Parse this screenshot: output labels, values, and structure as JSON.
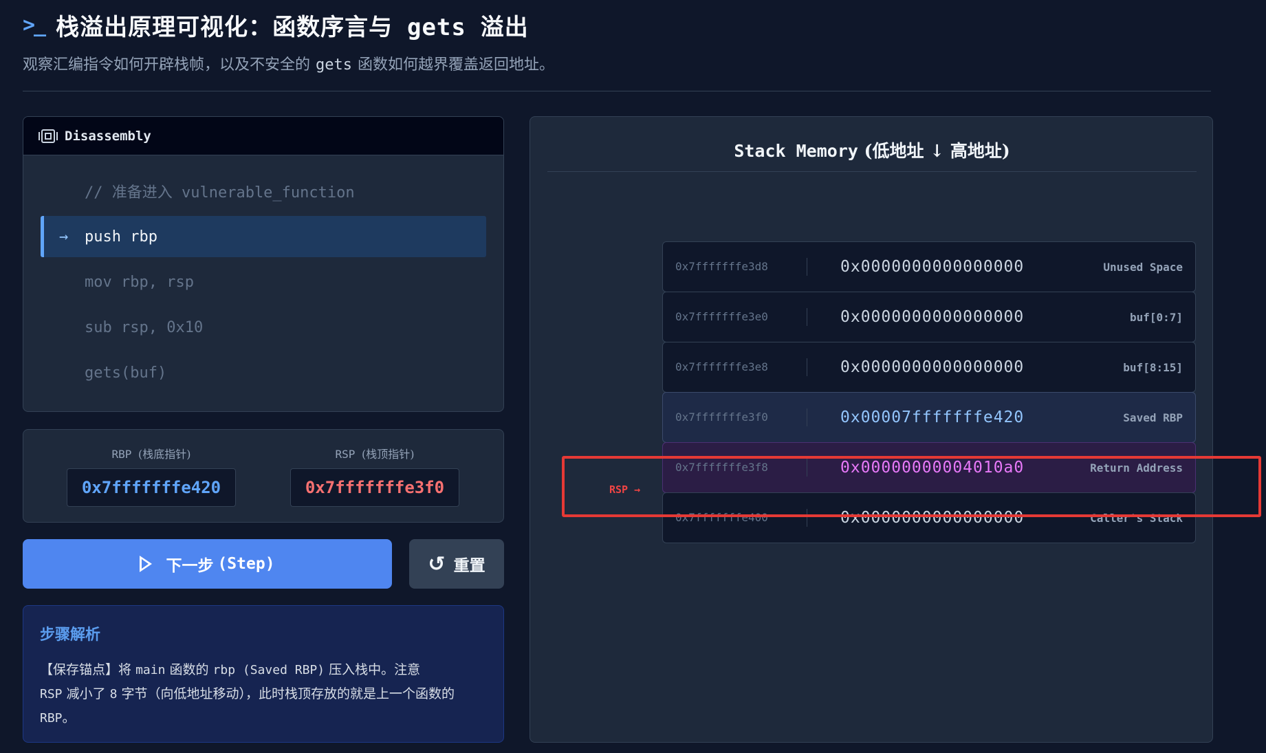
{
  "header": {
    "title_prefix": "栈溢出原理可视化：函数序言与",
    "title_code": "gets",
    "title_suffix": "溢出",
    "subtitle_prefix": "观察汇编指令如何开辟栈帧，以及不安全的",
    "subtitle_code": "gets",
    "subtitle_suffix": "函数如何越界覆盖返回地址。"
  },
  "disassembly": {
    "title": "Disassembly",
    "lines": [
      {
        "text": "// 准备进入 vulnerable_function",
        "active": false
      },
      {
        "text": "push rbp",
        "active": true
      },
      {
        "text": "mov rbp, rsp",
        "active": false
      },
      {
        "text": "sub rsp, 0x10",
        "active": false
      },
      {
        "text": "gets(buf)",
        "active": false
      }
    ],
    "active_marker": "→"
  },
  "registers": {
    "rbp": {
      "label": "RBP",
      "label_cn": "(栈底指针)",
      "value": "0x7fffffffe420"
    },
    "rsp": {
      "label": "RSP",
      "label_cn": "(栈顶指针)",
      "value": "0x7fffffffe3f0"
    }
  },
  "buttons": {
    "step_label": "下一步",
    "step_code": "(Step)",
    "reset_label": "重置",
    "reset_icon": "↺"
  },
  "explanation": {
    "title": "步骤解析",
    "p1": "【保存锚点】将",
    "c1": "main",
    "p2": "函数的",
    "c2": "rbp (Saved RBP)",
    "p3": "压入栈中。注意",
    "c3": "RSP",
    "p4": "减小了",
    "c4": "8",
    "p5": "字节（向低地址移动），此时栈顶存放的就是上一个函数的",
    "c5": "RBP",
    "p6": "。"
  },
  "stack": {
    "title_code": "Stack Memory",
    "title_cn": "(低地址 ↓ 高地址)",
    "rsp_pointer": "RSP →",
    "rows": [
      {
        "addr": "0x7fffffffe3d8",
        "value": "0x0000000000000000",
        "label": "Unused Space",
        "kind": "normal"
      },
      {
        "addr": "0x7fffffffe3e0",
        "value": "0x0000000000000000",
        "label": "buf[0:7]",
        "kind": "normal"
      },
      {
        "addr": "0x7fffffffe3e8",
        "value": "0x0000000000000000",
        "label": "buf[8:15]",
        "kind": "normal"
      },
      {
        "addr": "0x7fffffffe3f0",
        "value": "0x00007fffffffe420",
        "label": "Saved RBP",
        "kind": "saved"
      },
      {
        "addr": "0x7fffffffe3f8",
        "value": "0x00000000004010a0",
        "label": "Return Address",
        "kind": "ret"
      },
      {
        "addr": "0x7fffffffe400",
        "value": "0x0000000000000000",
        "label": "Caller's Stack",
        "kind": "normal"
      }
    ]
  },
  "colors": {
    "accent": "#4f86f0",
    "rbp": "#60a5fa",
    "rsp": "#f87171",
    "return_address": "#e879f9",
    "highlight": "#e53935"
  }
}
